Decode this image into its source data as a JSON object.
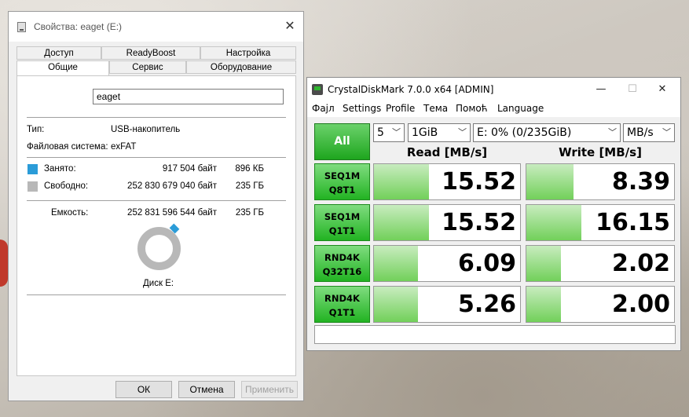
{
  "props": {
    "title": "Свойства: eaget (E:)",
    "close": "✕",
    "tabs_row1": [
      "Доступ",
      "ReadyBoost",
      "Настройка"
    ],
    "tabs_row2": [
      "Общие",
      "Сервис",
      "Оборудование"
    ],
    "name_value": "eaget",
    "type_label": "Тип:",
    "type_value": "USB-накопитель",
    "fs_label": "Файловая система:",
    "fs_value": "exFAT",
    "used_label": "Занято:",
    "used_bytes": "917 504 байт",
    "used_short": "896 КБ",
    "free_label": "Свободно:",
    "free_bytes": "252 830 679 040 байт",
    "free_short": "235 ГБ",
    "cap_label": "Емкость:",
    "cap_bytes": "252 831 596 544 байт",
    "cap_short": "235 ГБ",
    "disk_label": "Диск E:",
    "used_color": "#2b9cd8",
    "free_color": "#b8b8b8",
    "buttons": {
      "ok": "ОК",
      "cancel": "Отмена",
      "apply": "Применить"
    }
  },
  "cdm": {
    "title": "CrystalDiskMark 7.0.0 x64 [ADMIN]",
    "controls": {
      "minimize": "—",
      "maximize": "☐",
      "close": "✕"
    },
    "menu": [
      "Фаjл",
      "Settings",
      "Profile",
      "Тема",
      "Помоћ",
      "Language"
    ],
    "all_label": "All",
    "count": "5",
    "size": "1GiB",
    "drive": "E: 0% (0/235GiB)",
    "unit": "MB/s",
    "read_header": "Read [MB/s]",
    "write_header": "Write [MB/s]",
    "accent": "#22b322",
    "rows": [
      {
        "line1": "SEQ1M",
        "line2": "Q8T1",
        "read": "15.52",
        "write": "8.39"
      },
      {
        "line1": "SEQ1M",
        "line2": "Q1T1",
        "read": "15.52",
        "write": "16.15"
      },
      {
        "line1": "RND4K",
        "line2": "Q32T16",
        "read": "6.09",
        "write": "2.02"
      },
      {
        "line1": "RND4K",
        "line2": "Q1T1",
        "read": "5.26",
        "write": "2.00"
      }
    ],
    "comment": ""
  }
}
